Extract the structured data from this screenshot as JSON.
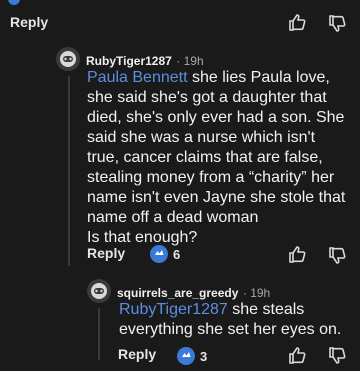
{
  "top_comment": {
    "reply_label": "Reply"
  },
  "comment1": {
    "username": "RubyTiger1287",
    "time": "· 19h",
    "mention": "Paula Bennett",
    "text": "she lies Paula love, she said she's got a daughter that died, she's only ever had a son. She said she was a nurse which isn't true, cancer claims that are false, stealing money from a “charity” her name isn't even Jayne she stole that name off a dead woman\nIs that enough?",
    "reply_label": "Reply",
    "reaction_count": "6"
  },
  "comment2": {
    "username": "squirrels_are_greedy",
    "time": "· 19h",
    "mention": "RubyTiger1287",
    "text": "she steals everything she set her eyes on.",
    "reply_label": "Reply",
    "reaction_count": "3"
  },
  "colors": {
    "background": "#1a1a1b",
    "mention": "#5b8fe0",
    "reaction_blue": "#3b7bd8"
  },
  "icons": [
    "thumbs-up-icon",
    "thumbs-down-icon",
    "avatar-icon",
    "reaction-icon"
  ]
}
